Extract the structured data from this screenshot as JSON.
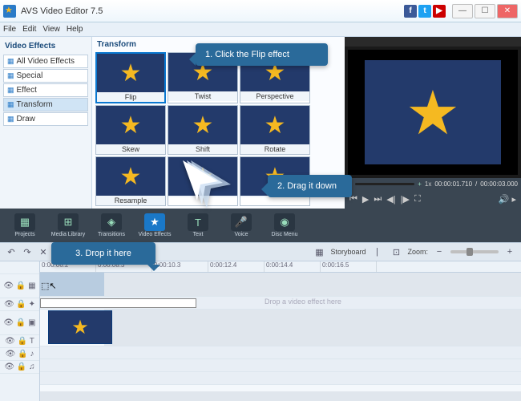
{
  "window": {
    "title": "AVS Video Editor 7.5",
    "menu": [
      "File",
      "Edit",
      "View",
      "Help"
    ]
  },
  "effects_panel": {
    "header": "Video Effects",
    "items": [
      "All Video Effects",
      "Special",
      "Effect",
      "Transform",
      "Draw"
    ],
    "selected": "Transform"
  },
  "thumb_panel": {
    "header": "Transform",
    "thumbs": [
      {
        "label": "Flip",
        "selected": true
      },
      {
        "label": "Twist"
      },
      {
        "label": "Perspective"
      },
      {
        "label": "Skew"
      },
      {
        "label": "Shift"
      },
      {
        "label": "Rotate"
      },
      {
        "label": "Resample"
      },
      {
        "label": ""
      },
      {
        "label": ""
      }
    ]
  },
  "preview": {
    "speed": "1x",
    "time_current": "00:00:01.710",
    "time_total": "00:00:03.000"
  },
  "toolbar": {
    "buttons": [
      {
        "label": "Projects",
        "icon": "▦"
      },
      {
        "label": "Media Library",
        "icon": "⊞"
      },
      {
        "label": "Transitions",
        "icon": "◈"
      },
      {
        "label": "Video Effects",
        "icon": "★",
        "active": true
      },
      {
        "label": "Text",
        "icon": "T"
      },
      {
        "label": "Voice",
        "icon": "🎤"
      },
      {
        "label": "Disc Menu",
        "icon": "◉"
      }
    ]
  },
  "timebar": {
    "storyboard": "Storyboard",
    "zoom": "Zoom:"
  },
  "ruler": [
    "0:00:06.2",
    "0:00:08.3",
    "0:00:10.3",
    "0:00:12.4",
    "0:00:14.4",
    "0:00:16.5"
  ],
  "timeline": {
    "effect_hint": "Drop a video effect here"
  },
  "callouts": {
    "c1": "1. Click the Flip effect",
    "c2": "2. Drag it down",
    "c3": "3. Drop it here"
  }
}
